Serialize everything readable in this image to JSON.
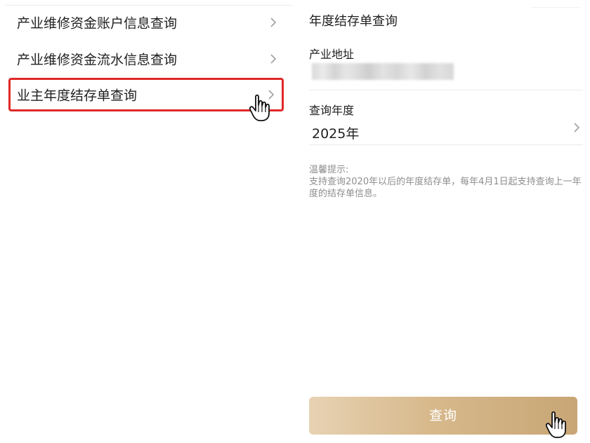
{
  "left_menu": {
    "items": [
      {
        "label": "产业维修资金账户信息查询"
      },
      {
        "label": "产业维修资金流水信息查询"
      },
      {
        "label": "业主年度结存单查询"
      }
    ]
  },
  "right_form": {
    "title": "年度结存单查询",
    "address_label": "产业地址",
    "year_label": "查询年度",
    "year_value": "2025年",
    "tip_title": "温馨提示:",
    "tip_line1": "支持查询2020年以后的年度结存单，每年4月1日起支持查询上一年度的结存单信息。",
    "query_button": "查询"
  },
  "colors": {
    "highlight_border": "#e02828",
    "button_gold": "#d7b98c",
    "tip_text": "#8e8e8e"
  },
  "icons": [
    "chevron-right-icon",
    "hand-pointer-icon"
  ]
}
